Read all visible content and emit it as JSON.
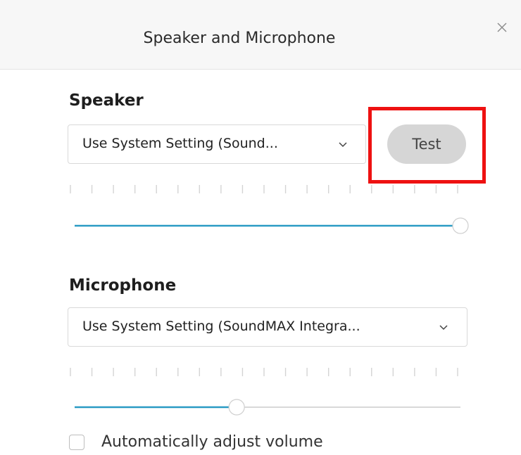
{
  "dialog": {
    "title": "Speaker and Microphone"
  },
  "speaker": {
    "heading": "Speaker",
    "device": "Use System Setting (Sound...",
    "test_label": "Test",
    "volume_fraction": 1.0
  },
  "microphone": {
    "heading": "Microphone",
    "device": "Use System Setting (SoundMAX Integra...",
    "volume_fraction": 0.42
  },
  "auto_adjust": {
    "label": "Automatically adjust volume",
    "checked": false
  },
  "icons": {
    "close": "close-icon",
    "dropdown": "chevron-down-icon"
  },
  "colors": {
    "accent": "#2a9bc4",
    "track": "#d8d8d8",
    "highlight": "#ee1111",
    "test_button": "#d6d6d6"
  }
}
